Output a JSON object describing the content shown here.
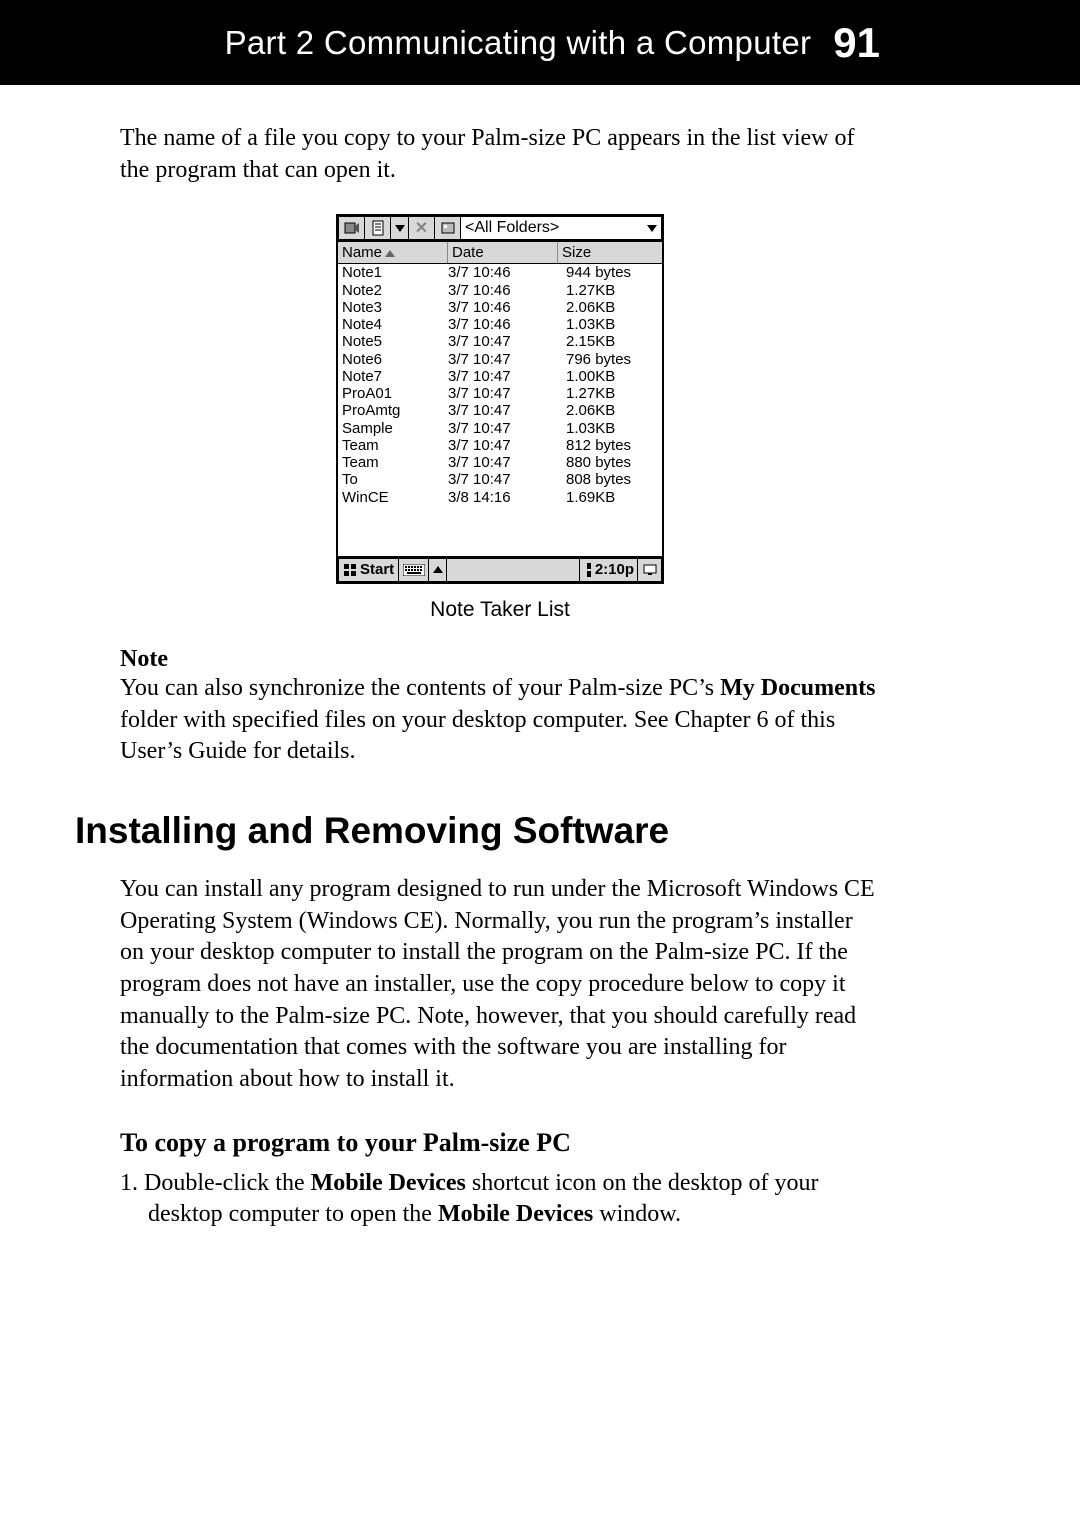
{
  "header": {
    "part_label": "Part 2  Communicating with a Computer",
    "page_number": "91"
  },
  "intro_para": "The name of a file you copy to your Palm-size PC appears in the list view of the program that can open it.",
  "device": {
    "folder_label": "<All Folders>",
    "columns": {
      "name": "Name",
      "date": "Date",
      "size": "Size"
    },
    "rows": [
      {
        "name": "Note1",
        "date": "3/7 10:46",
        "size": "944 bytes"
      },
      {
        "name": "Note2",
        "date": "3/7 10:46",
        "size": "1.27KB"
      },
      {
        "name": "Note3",
        "date": "3/7 10:46",
        "size": "2.06KB"
      },
      {
        "name": "Note4",
        "date": "3/7 10:46",
        "size": "1.03KB"
      },
      {
        "name": "Note5",
        "date": "3/7 10:47",
        "size": "2.15KB"
      },
      {
        "name": "Note6",
        "date": "3/7 10:47",
        "size": "796 bytes"
      },
      {
        "name": "Note7",
        "date": "3/7 10:47",
        "size": "1.00KB"
      },
      {
        "name": "ProA01",
        "date": "3/7 10:47",
        "size": "1.27KB"
      },
      {
        "name": "ProAmtg",
        "date": "3/7 10:47",
        "size": "2.06KB"
      },
      {
        "name": "Sample",
        "date": "3/7 10:47",
        "size": "1.03KB"
      },
      {
        "name": "Team",
        "date": "3/7 10:47",
        "size": "812 bytes"
      },
      {
        "name": "Team",
        "date": "3/7 10:47",
        "size": "880 bytes"
      },
      {
        "name": "To",
        "date": "3/7 10:47",
        "size": "808 bytes"
      },
      {
        "name": "WinCE",
        "date": "3/8 14:16",
        "size": "1.69KB"
      }
    ],
    "start_label": "Start",
    "clock_label": "2:10p"
  },
  "caption": "Note Taker List",
  "note": {
    "label": "Note",
    "text_before": "You can also synchronize the contents of your Palm-size PC’s ",
    "bold1": "My Documents",
    "text_after": " folder with specified files on your desktop computer. See Chapter 6 of this User’s Guide for details."
  },
  "section": {
    "title": "Installing and Removing Software",
    "para": "You can install any program designed to run under the Microsoft Windows CE Operating System (Windows CE). Normally, you run the program’s installer on your desktop computer to install the program on the Palm-size PC. If the program does not have an installer, use the copy procedure below to copy it manually to the Palm-size PC. Note, however, that you should carefully read the documentation that comes with the software you are installing for information about how to install it.",
    "sub_title": "To copy a program to your Palm-size PC",
    "step1_prefix": "1. Double-click the ",
    "step1_bold1": "Mobile Devices",
    "step1_mid": " shortcut icon on the desktop of your desktop computer to open the ",
    "step1_bold2": "Mobile Devices",
    "step1_suffix": " window."
  }
}
